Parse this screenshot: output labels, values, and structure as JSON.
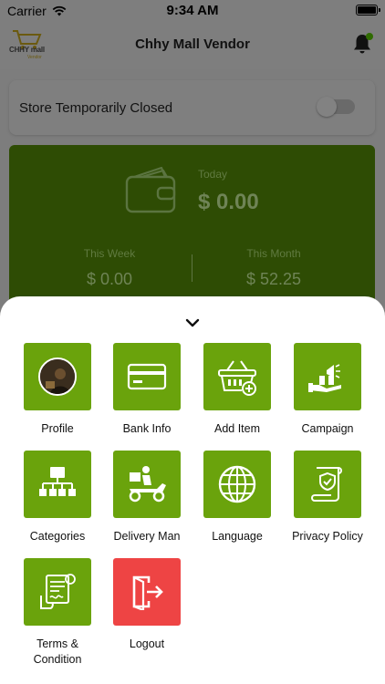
{
  "status_bar": {
    "carrier": "Carrier",
    "time": "9:34 AM"
  },
  "app_bar": {
    "title": "Chhy Mall Vendor",
    "logo_text": "CHHY mall",
    "logo_sub": "Vendor"
  },
  "store": {
    "label": "Store Temporarily Closed",
    "toggle_on": false
  },
  "earnings": {
    "today_label": "Today",
    "today_value": "$ 0.00",
    "week_label": "This Week",
    "week_value": "$ 0.00",
    "month_label": "This Month",
    "month_value": "$ 52.25"
  },
  "menu": {
    "items": [
      {
        "label": "Profile"
      },
      {
        "label": "Bank Info"
      },
      {
        "label": "Add Item"
      },
      {
        "label": "Campaign"
      },
      {
        "label": "Categories"
      },
      {
        "label": "Delivery Man"
      },
      {
        "label": "Language"
      },
      {
        "label": "Privacy Policy"
      },
      {
        "label": "Terms & Condition"
      },
      {
        "label": "Logout"
      }
    ]
  },
  "colors": {
    "accent": "#6aa30c",
    "logout": "#ee4444",
    "overlay": "#7e7e7e"
  }
}
